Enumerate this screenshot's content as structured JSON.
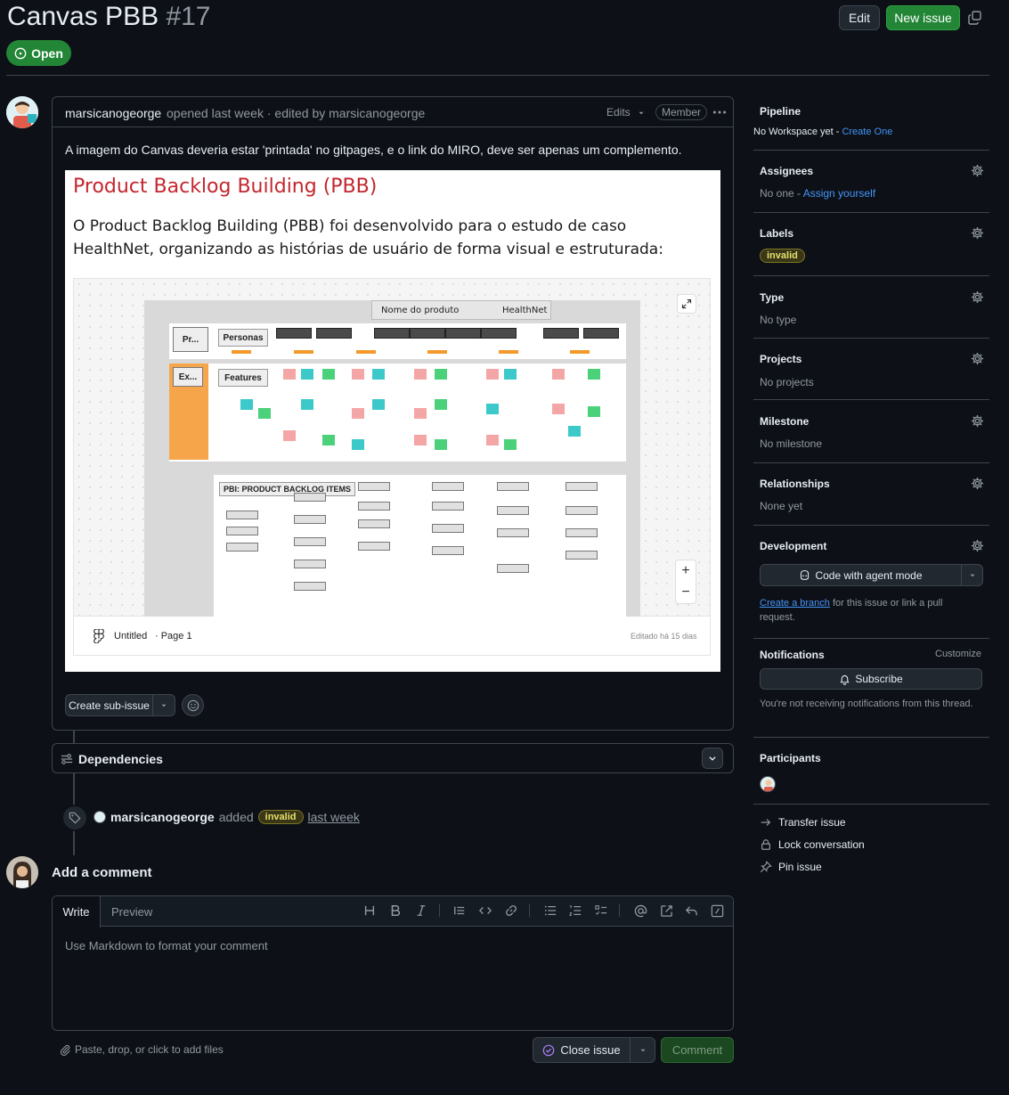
{
  "header": {
    "title": "Canvas PBB",
    "number": "#17",
    "edit_label": "Edit",
    "new_issue_label": "New issue",
    "state_label": "Open"
  },
  "comment": {
    "author": "marsicanogeorge",
    "meta": "opened last week · edited by marsicanogeorge",
    "edits_label": "Edits",
    "member_badge": "Member",
    "body_text": "A imagem do Canvas deveria estar 'printada' no gitpages, e o link do MIRO, deve ser apenas um complemento.",
    "create_sub_issue_label": "Create sub-issue"
  },
  "embed": {
    "heading": "Product Backlog Building (PBB)",
    "paragraph": "O Product Backlog Building (PBB) foi desenvolvido para o estudo de caso HealthNet, organizando as histórias de usuário de forma visual e estruturada:",
    "product_name_label": "Nome do produto",
    "product_name_value": "HealthNet",
    "section_pr": "Pr...",
    "section_personas": "Personas",
    "section_ex": "Ex...",
    "section_features": "Features",
    "section_pbi": "PBI: PRODUCT BACKLOG ITEMS",
    "file_name": "Untitled",
    "page_name": "· Page 1",
    "edited": "Editado há 15 dias",
    "zoom_in": "+",
    "zoom_out": "−"
  },
  "dependencies": {
    "title": "Dependencies"
  },
  "timeline": {
    "actor": "marsicanogeorge",
    "action": "added",
    "label": "invalid",
    "when": "last week"
  },
  "add_comment": {
    "title": "Add a comment",
    "tab_write": "Write",
    "tab_preview": "Preview",
    "placeholder": "Use Markdown to format your comment",
    "attach_hint": "Paste, drop, or click to add files",
    "close_issue_label": "Close issue",
    "comment_label": "Comment"
  },
  "sidebar": {
    "pipeline": {
      "title": "Pipeline",
      "value": "No Workspace yet - ",
      "link": "Create One"
    },
    "assignees": {
      "title": "Assignees",
      "value": "No one - ",
      "link": "Assign yourself"
    },
    "labels": {
      "title": "Labels",
      "label": "invalid"
    },
    "type": {
      "title": "Type",
      "value": "No type"
    },
    "projects": {
      "title": "Projects",
      "value": "No projects"
    },
    "milestone": {
      "title": "Milestone",
      "value": "No milestone"
    },
    "relationships": {
      "title": "Relationships",
      "value": "None yet"
    },
    "development": {
      "title": "Development",
      "agent_button": "Code with agent mode",
      "branch_link": "Create a branch",
      "branch_text": " for this issue or link a pull request."
    },
    "notifications": {
      "title": "Notifications",
      "customize": "Customize",
      "subscribe": "Subscribe",
      "note": "You're not receiving notifications from this thread."
    },
    "participants": {
      "title": "Participants"
    },
    "actions": {
      "transfer": "Transfer issue",
      "lock": "Lock conversation",
      "pin": "Pin issue"
    }
  },
  "colors": {
    "bg": "#0d1117",
    "green": "#238636",
    "link": "#4493f8",
    "heading_red": "#c4262e",
    "label_yellow": "#e6e06a"
  }
}
